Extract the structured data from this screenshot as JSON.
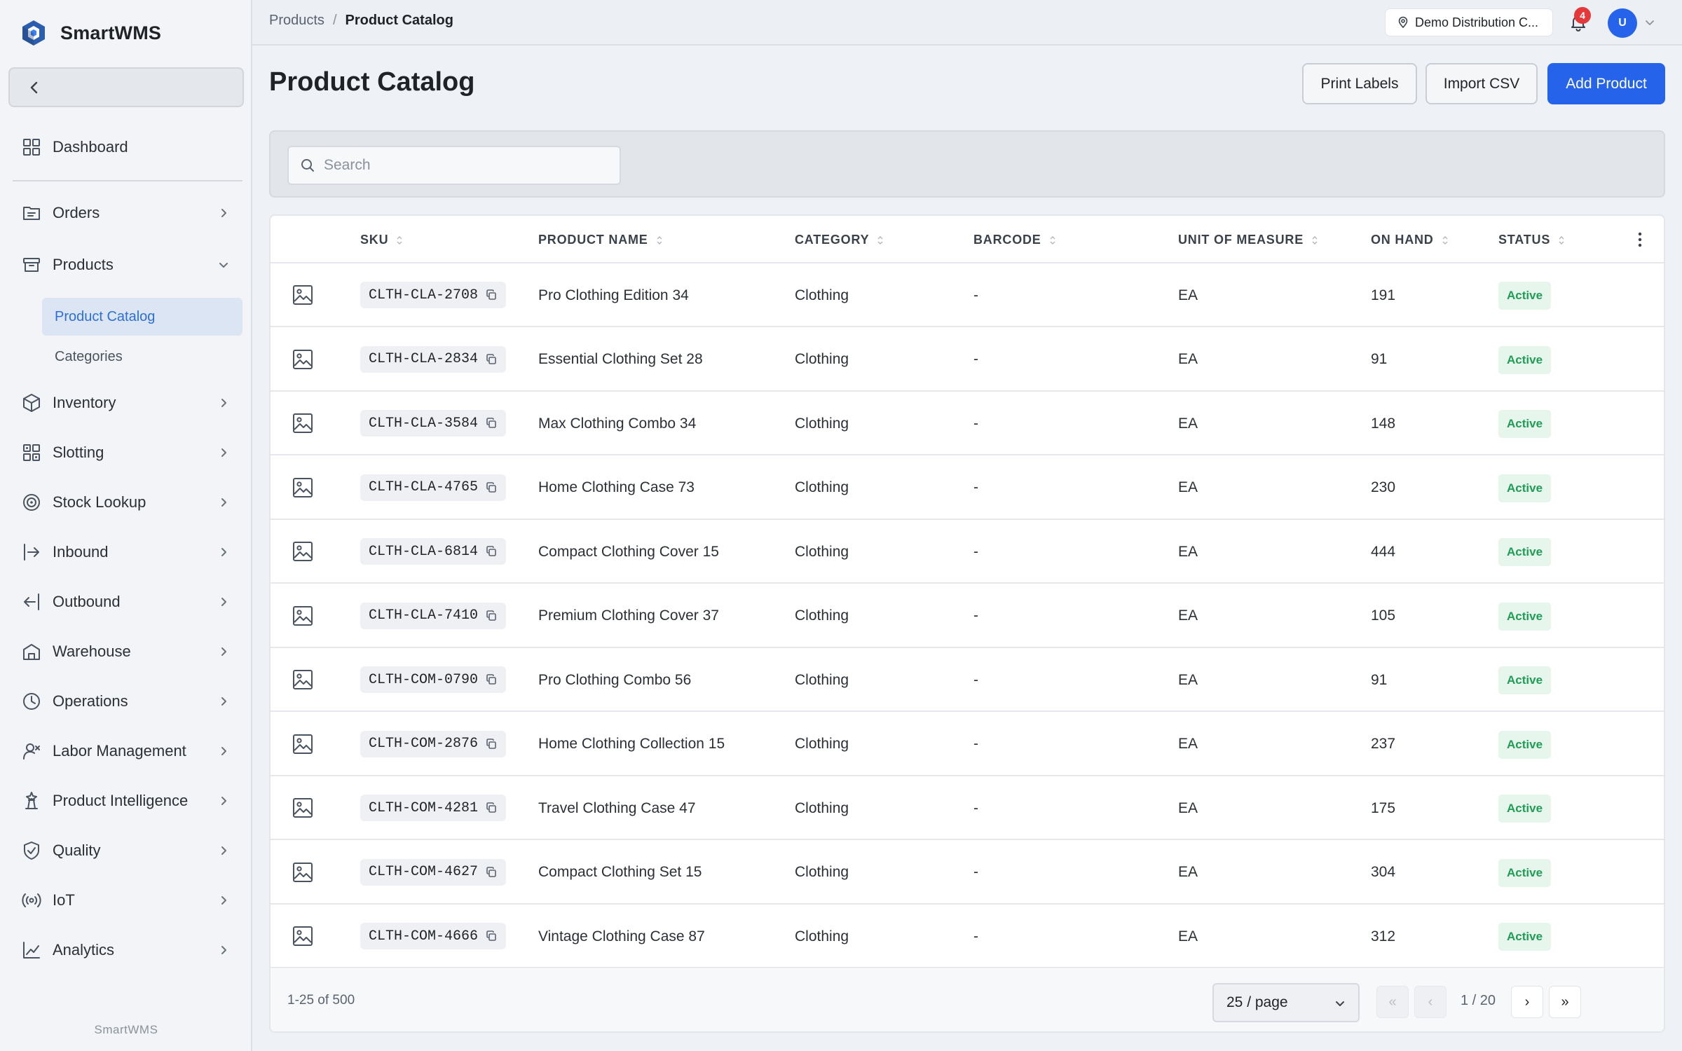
{
  "brand": {
    "name": "SmartWMS"
  },
  "sidebar": {
    "nav": [
      {
        "label": "Dashboard",
        "icon": "dashboard-grid-icon",
        "expandable": false
      },
      {
        "label": "Orders",
        "icon": "orders-icon",
        "expandable": true
      },
      {
        "label": "Products",
        "icon": "products-box-icon",
        "expandable": true,
        "expanded": true
      },
      {
        "label": "Inventory",
        "icon": "inventory-cube-icon",
        "expandable": true
      },
      {
        "label": "Slotting",
        "icon": "slotting-grid-icon",
        "expandable": true
      },
      {
        "label": "Stock Lookup",
        "icon": "stock-lookup-target-icon",
        "expandable": true
      },
      {
        "label": "Inbound",
        "icon": "inbound-arrow-icon",
        "expandable": true
      },
      {
        "label": "Outbound",
        "icon": "outbound-arrow-icon",
        "expandable": true
      },
      {
        "label": "Warehouse",
        "icon": "warehouse-icon",
        "expandable": true
      },
      {
        "label": "Operations",
        "icon": "clock-icon",
        "expandable": true
      },
      {
        "label": "Labor Management",
        "icon": "user-icon",
        "expandable": true
      },
      {
        "label": "Product Intelligence",
        "icon": "intelligence-icon",
        "expandable": true
      },
      {
        "label": "Quality",
        "icon": "shield-check-icon",
        "expandable": true
      },
      {
        "label": "IoT",
        "icon": "radio-signal-icon",
        "expandable": true
      },
      {
        "label": "Analytics",
        "icon": "line-chart-icon",
        "expandable": true
      }
    ],
    "sub_items": [
      {
        "label": "Product Catalog",
        "active": true
      },
      {
        "label": "Categories",
        "active": false
      }
    ],
    "footer": "SmartWMS"
  },
  "topbar": {
    "breadcrumb": [
      "Products",
      "Product Catalog"
    ],
    "location": "Demo Distribution C...",
    "notifications": "4",
    "avatar_initial": "U"
  },
  "page": {
    "title": "Product Catalog",
    "buttons": {
      "print": "Print Labels",
      "import": "Import CSV",
      "add": "Add Product"
    }
  },
  "search": {
    "placeholder": "Search",
    "value": ""
  },
  "table": {
    "columns": [
      "SKU",
      "PRODUCT NAME",
      "CATEGORY",
      "BARCODE",
      "UNIT OF MEASURE",
      "ON HAND",
      "STATUS"
    ],
    "rows": [
      {
        "sku": "CLTH-CLA-2708",
        "name": "Pro Clothing Edition 34",
        "category": "Clothing",
        "barcode": "-",
        "uom": "EA",
        "on_hand": "191",
        "status": "Active"
      },
      {
        "sku": "CLTH-CLA-2834",
        "name": "Essential Clothing Set 28",
        "category": "Clothing",
        "barcode": "-",
        "uom": "EA",
        "on_hand": "91",
        "status": "Active"
      },
      {
        "sku": "CLTH-CLA-3584",
        "name": "Max Clothing Combo 34",
        "category": "Clothing",
        "barcode": "-",
        "uom": "EA",
        "on_hand": "148",
        "status": "Active"
      },
      {
        "sku": "CLTH-CLA-4765",
        "name": "Home Clothing Case 73",
        "category": "Clothing",
        "barcode": "-",
        "uom": "EA",
        "on_hand": "230",
        "status": "Active"
      },
      {
        "sku": "CLTH-CLA-6814",
        "name": "Compact Clothing Cover 15",
        "category": "Clothing",
        "barcode": "-",
        "uom": "EA",
        "on_hand": "444",
        "status": "Active"
      },
      {
        "sku": "CLTH-CLA-7410",
        "name": "Premium Clothing Cover 37",
        "category": "Clothing",
        "barcode": "-",
        "uom": "EA",
        "on_hand": "105",
        "status": "Active"
      },
      {
        "sku": "CLTH-COM-0790",
        "name": "Pro Clothing Combo 56",
        "category": "Clothing",
        "barcode": "-",
        "uom": "EA",
        "on_hand": "91",
        "status": "Active"
      },
      {
        "sku": "CLTH-COM-2876",
        "name": "Home Clothing Collection 15",
        "category": "Clothing",
        "barcode": "-",
        "uom": "EA",
        "on_hand": "237",
        "status": "Active"
      },
      {
        "sku": "CLTH-COM-4281",
        "name": "Travel Clothing Case 47",
        "category": "Clothing",
        "barcode": "-",
        "uom": "EA",
        "on_hand": "175",
        "status": "Active"
      },
      {
        "sku": "CLTH-COM-4627",
        "name": "Compact Clothing Set 15",
        "category": "Clothing",
        "barcode": "-",
        "uom": "EA",
        "on_hand": "304",
        "status": "Active"
      },
      {
        "sku": "CLTH-COM-4666",
        "name": "Vintage Clothing Case 87",
        "category": "Clothing",
        "barcode": "-",
        "uom": "EA",
        "on_hand": "312",
        "status": "Active"
      }
    ]
  },
  "pagination": {
    "range": "1-25 of 500",
    "page_size": "25 / page",
    "page_info": "1 / 20",
    "first": "«",
    "prev": "‹",
    "next": "›",
    "last": "»"
  },
  "colors": {
    "accent": "#2563eb",
    "active_status": "#1f9d55",
    "active_status_bg": "#e7f6ec",
    "notification": "#e5383b"
  }
}
